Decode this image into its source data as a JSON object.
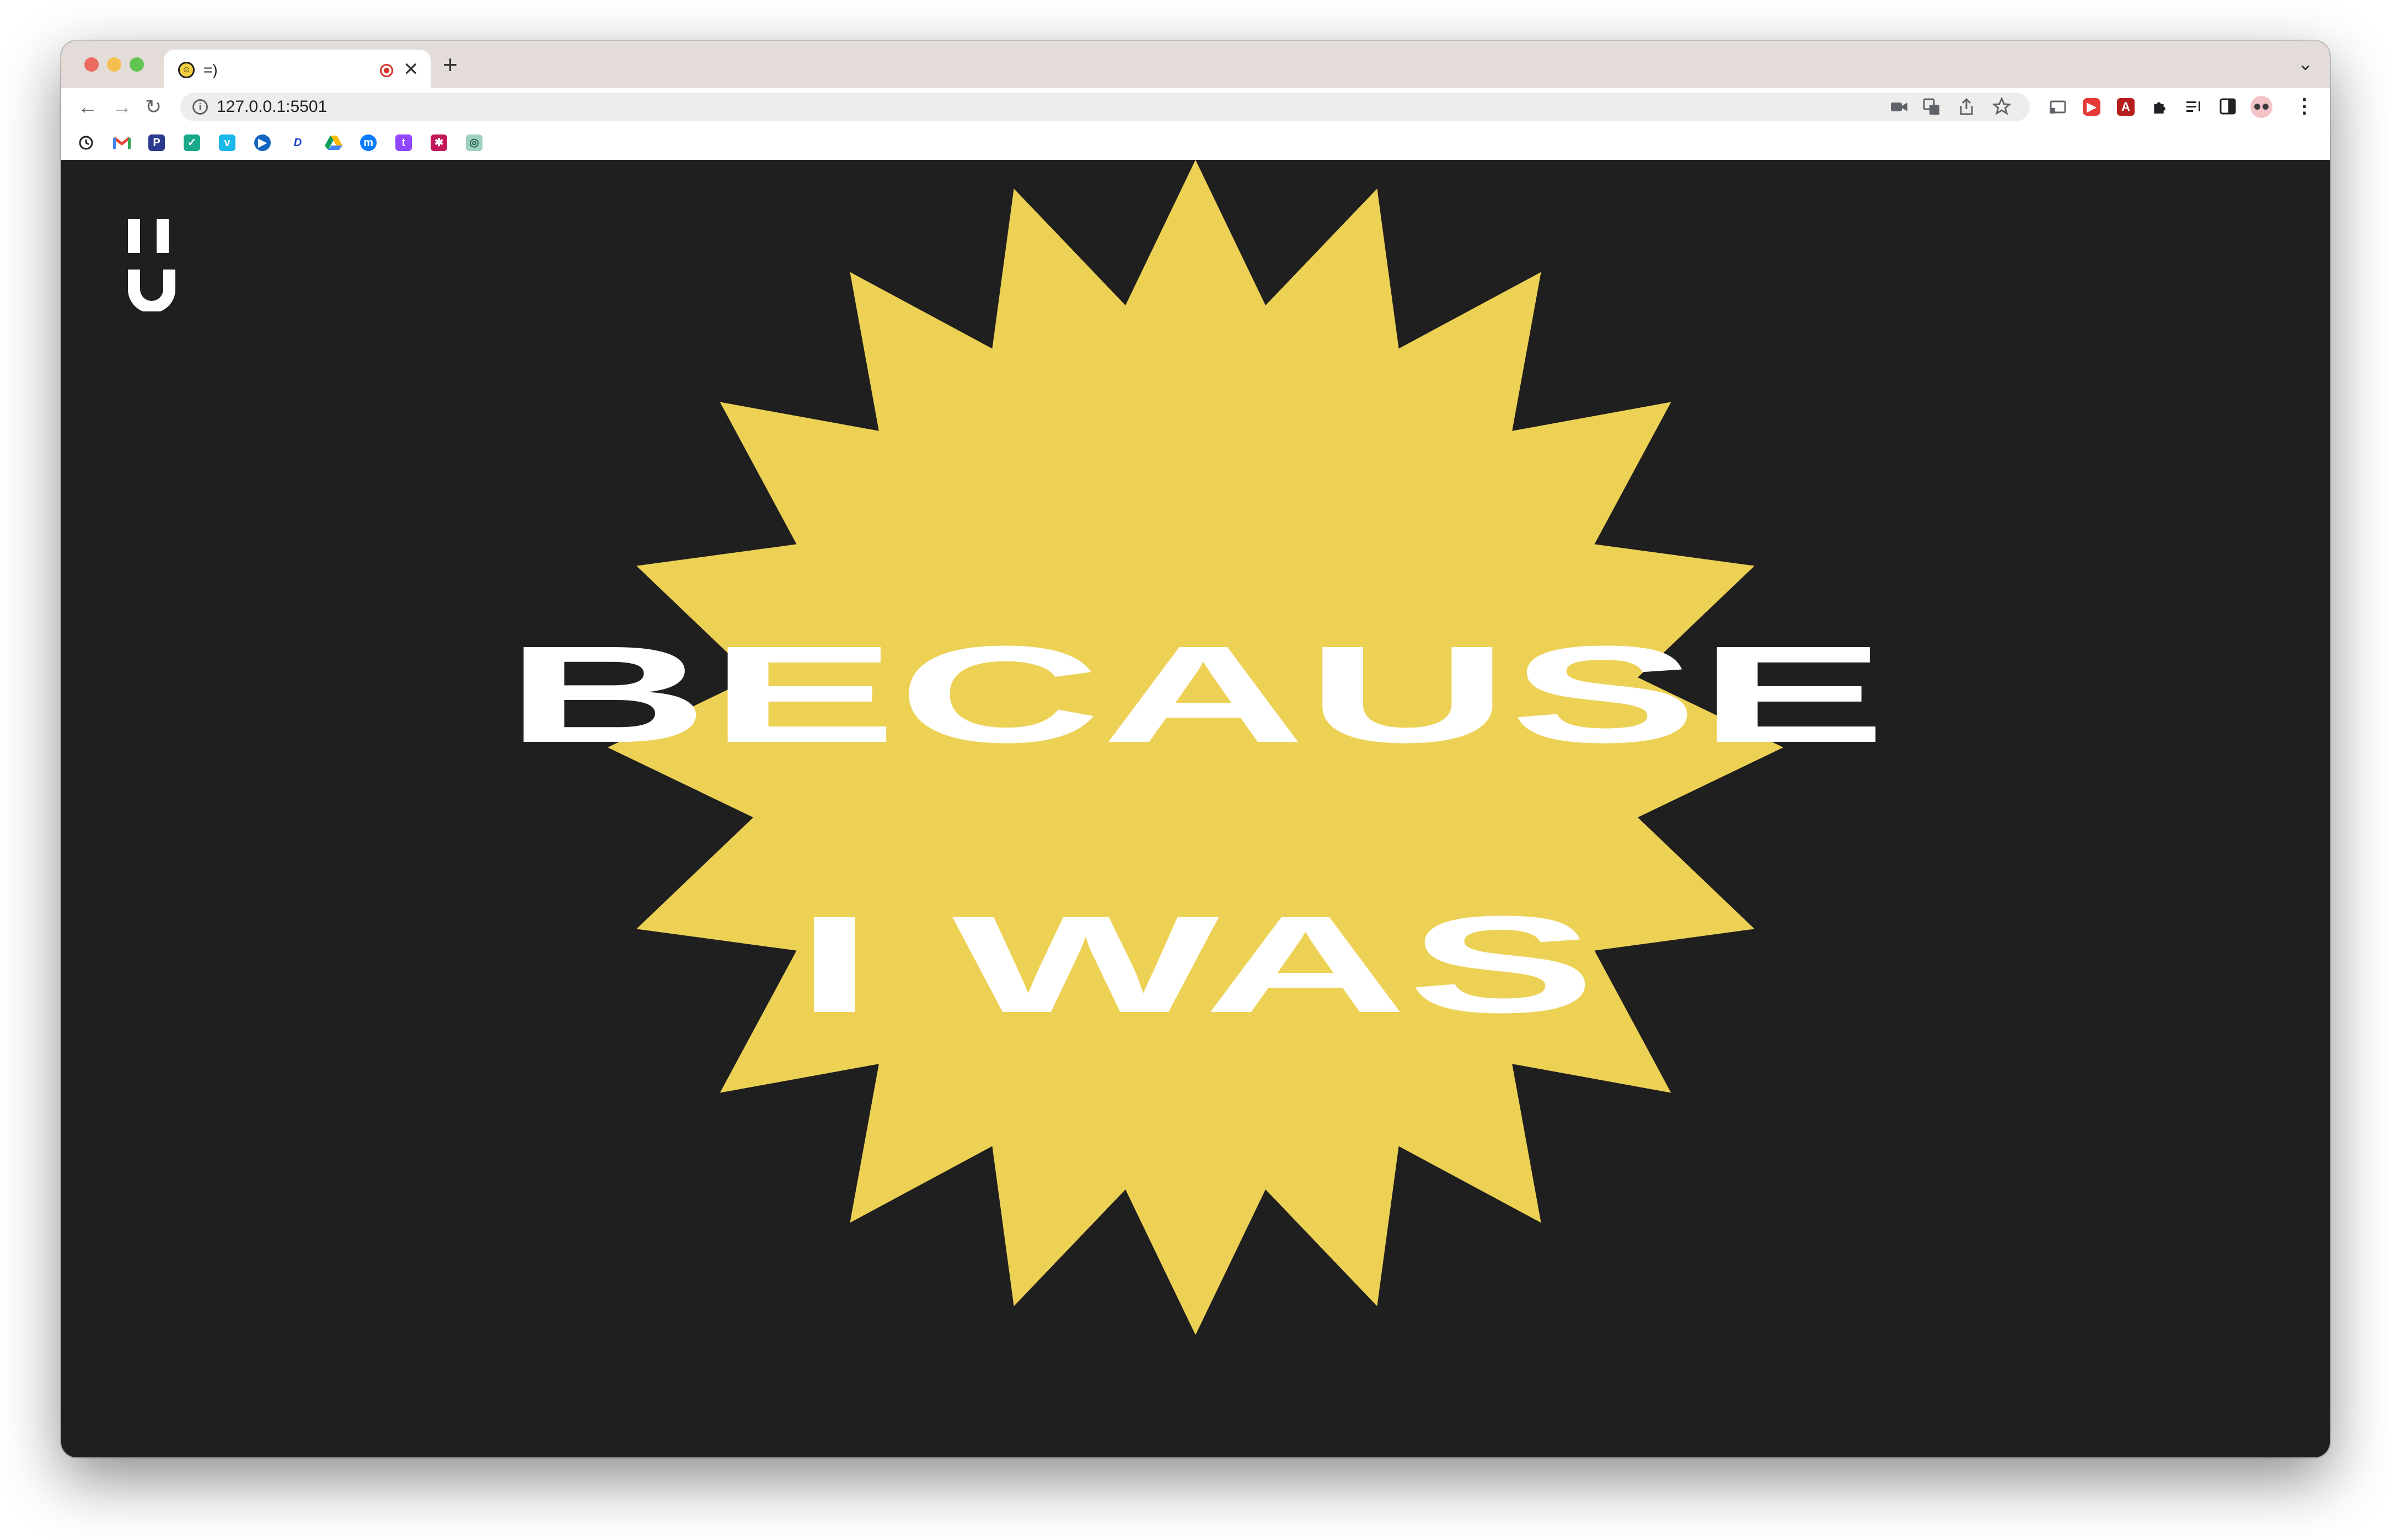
{
  "browser": {
    "tab": {
      "title": "=)",
      "close_glyph": "✕",
      "favicon_glyph": "☺"
    },
    "new_tab_glyph": "+",
    "tab_menu_glyph": "⌄",
    "nav": {
      "back": "←",
      "forward": "→",
      "reload": "↻"
    },
    "address": {
      "url": "127.0.0.1:5501",
      "info_glyph": "i"
    },
    "omnibox_icons": [
      "camera-icon",
      "translate-icon",
      "share-icon",
      "bookmark-star-icon"
    ],
    "extension_icons": [
      "cast-icon",
      "youtube-icon",
      "pdf-icon",
      "extensions-puzzle-icon",
      "reading-list-icon",
      "side-panel-icon",
      "profile-avatar-icon",
      "more-menu-icon"
    ],
    "bookmarks": [
      "history-icon",
      "gmail-icon",
      "pixabay-icon",
      "check-icon",
      "vimeo-icon",
      "play-icon",
      "disney-icon",
      "drive-icon",
      "messenger-icon",
      "twitch-icon",
      "bookmark-app-icon",
      "chatgpt-icon"
    ]
  },
  "page": {
    "headline_line1": "BECAUSE",
    "headline_line2": "I WAS",
    "colors": {
      "background": "#1f1f1f",
      "burst": "#edd155",
      "text": "#ffffff"
    }
  }
}
